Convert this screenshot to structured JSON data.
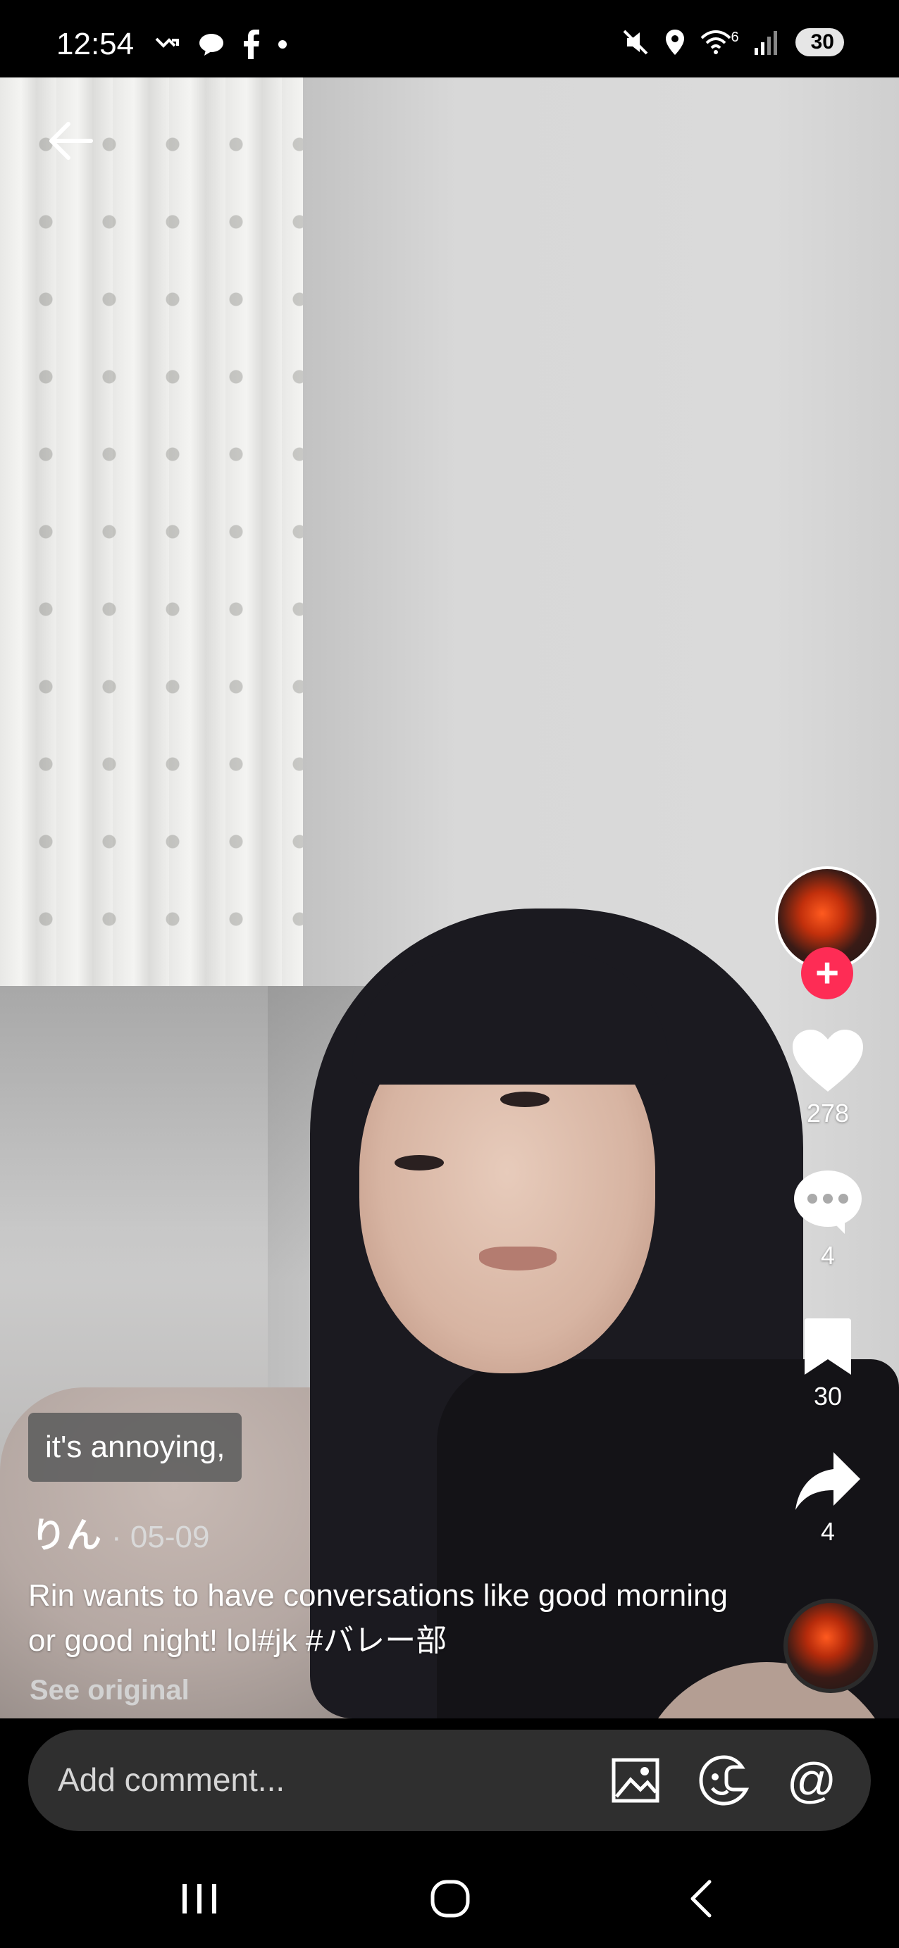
{
  "status_bar": {
    "time": "12:54",
    "battery": "30",
    "icons_left": [
      "missed-call-icon",
      "chat-bubble-icon",
      "facebook-icon",
      "dot-icon"
    ],
    "icons_right": [
      "mute-icon",
      "location-icon",
      "wifi-icon",
      "signal-icon",
      "battery-icon"
    ],
    "wifi_label": "6"
  },
  "video": {
    "subtitle": "it's annoying,"
  },
  "actions": {
    "likes": "278",
    "comments": "4",
    "saves": "30",
    "shares": "4"
  },
  "post": {
    "author": "りん",
    "date": "· 05-09",
    "description": "Rin wants to have conversations like good morning or good night! lol#jk #バレー部",
    "see_original": "See original"
  },
  "comment_bar": {
    "placeholder": "Add comment..."
  },
  "colors": {
    "accent": "#fe2c55",
    "comment_pill": "#2f2f2f",
    "subtitle_chip": "#5f5f5f"
  }
}
